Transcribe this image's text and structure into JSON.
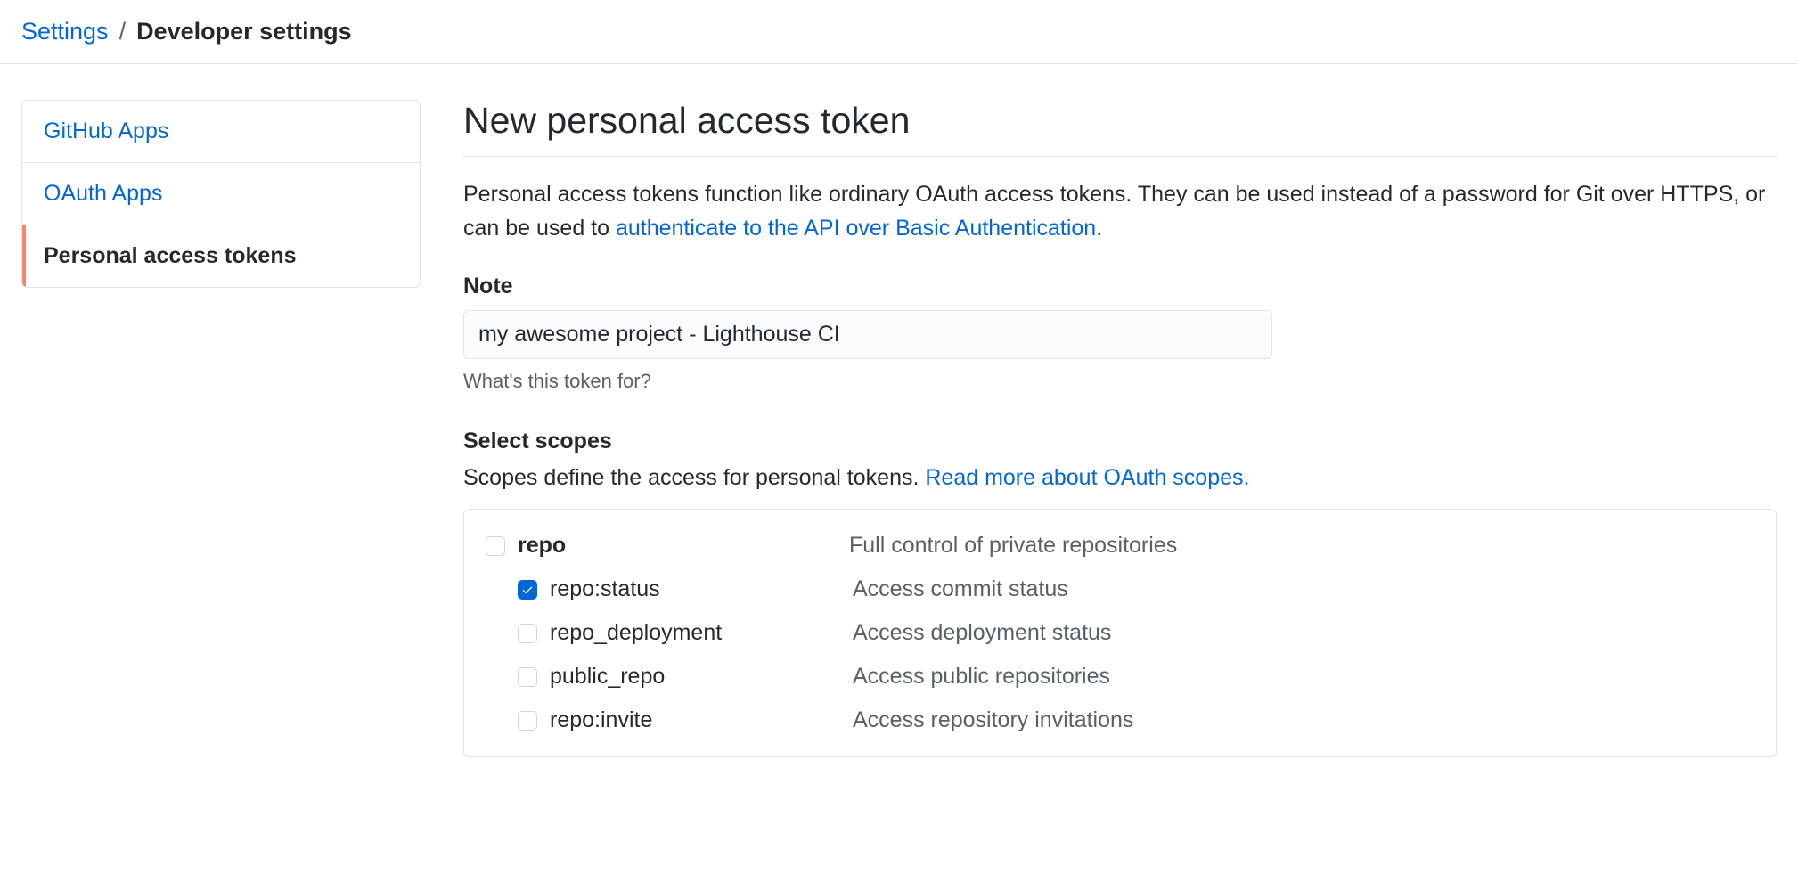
{
  "breadcrumb": {
    "parent": "Settings",
    "separator": "/",
    "current": "Developer settings"
  },
  "sidebar": {
    "items": [
      {
        "label": "GitHub Apps",
        "active": false
      },
      {
        "label": "OAuth Apps",
        "active": false
      },
      {
        "label": "Personal access tokens",
        "active": true
      }
    ]
  },
  "main": {
    "title": "New personal access token",
    "description_prefix": "Personal access tokens function like ordinary OAuth access tokens. They can be used instead of a password for Git over HTTPS, or can be used to ",
    "description_link": "authenticate to the API over Basic Authentication",
    "description_suffix": ".",
    "note": {
      "label": "Note",
      "value": "my awesome project - Lighthouse CI",
      "help": "What's this token for?"
    },
    "scopes": {
      "label": "Select scopes",
      "description_prefix": "Scopes define the access for personal tokens. ",
      "description_link": "Read more about OAuth scopes.",
      "items": [
        {
          "name": "repo",
          "description": "Full control of private repositories",
          "checked": false,
          "parent": true
        },
        {
          "name": "repo:status",
          "description": "Access commit status",
          "checked": true,
          "parent": false
        },
        {
          "name": "repo_deployment",
          "description": "Access deployment status",
          "checked": false,
          "parent": false
        },
        {
          "name": "public_repo",
          "description": "Access public repositories",
          "checked": false,
          "parent": false
        },
        {
          "name": "repo:invite",
          "description": "Access repository invitations",
          "checked": false,
          "parent": false
        }
      ]
    }
  }
}
